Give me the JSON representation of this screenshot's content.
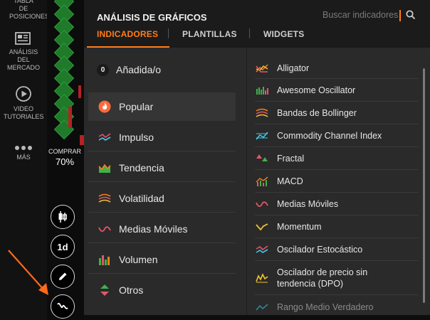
{
  "sidebar": {
    "items": [
      {
        "label": "TABLA DE POSICIONES",
        "icon": "trophy-icon"
      },
      {
        "label": "ANÁLISIS DEL MERCADO",
        "icon": "newspaper-icon"
      },
      {
        "label": "VIDEO TUTORIALES",
        "icon": "play-icon"
      },
      {
        "label": "MÁS",
        "icon": "more-dots-icon"
      }
    ]
  },
  "trade": {
    "buy_label": "COMPRAR",
    "buy_percent": "70%"
  },
  "chart_tools": {
    "timeframe": "1d",
    "buttons": [
      "candles-icon",
      "timeframe-button",
      "pencil-icon",
      "indicators-icon"
    ]
  },
  "panel": {
    "title": "ANÁLISIS DE GRÁFICOS",
    "search_placeholder": "Buscar indicadores",
    "tabs": [
      {
        "label": "INDICADORES",
        "active": true
      },
      {
        "label": "PLANTILLAS",
        "active": false
      },
      {
        "label": "WIDGETS",
        "active": false
      }
    ],
    "added": {
      "count": "0",
      "label": "Añadida/o"
    },
    "categories": [
      {
        "label": "Popular",
        "icon": "flame-icon",
        "active": true
      },
      {
        "label": "Impulso",
        "icon": "impulse-icon",
        "active": false
      },
      {
        "label": "Tendencia",
        "icon": "trend-icon",
        "active": false
      },
      {
        "label": "Volatilidad",
        "icon": "volatility-icon",
        "active": false
      },
      {
        "label": "Medias Móviles",
        "icon": "moving-average-icon",
        "active": false
      },
      {
        "label": "Volumen",
        "icon": "volume-icon",
        "active": false
      },
      {
        "label": "Otros",
        "icon": "others-icon",
        "active": false
      }
    ],
    "indicators": [
      {
        "label": "Alligator",
        "icon": "alligator-icon"
      },
      {
        "label": "Awesome Oscillator",
        "icon": "awesome-oscillator-icon"
      },
      {
        "label": "Bandas de Bollinger",
        "icon": "bollinger-icon"
      },
      {
        "label": "Commodity Channel Index",
        "icon": "cci-icon"
      },
      {
        "label": "Fractal",
        "icon": "fractal-icon"
      },
      {
        "label": "MACD",
        "icon": "macd-icon"
      },
      {
        "label": "Medias Móviles",
        "icon": "moving-average-icon"
      },
      {
        "label": "Momentum",
        "icon": "momentum-icon"
      },
      {
        "label": "Oscilador Estocástico",
        "icon": "stochastic-icon"
      },
      {
        "label": "Oscilador de precio sin tendencia (DPO)",
        "icon": "dpo-icon"
      },
      {
        "label": "Rango Medio Verdadero",
        "icon": "atr-icon"
      }
    ]
  },
  "colors": {
    "accent": "#ff7d1a",
    "panel_bg": "#2a2a2a",
    "header_bg": "#1b1b1b",
    "candle_green": "#1f7a2a",
    "candle_red": "#b52222"
  }
}
